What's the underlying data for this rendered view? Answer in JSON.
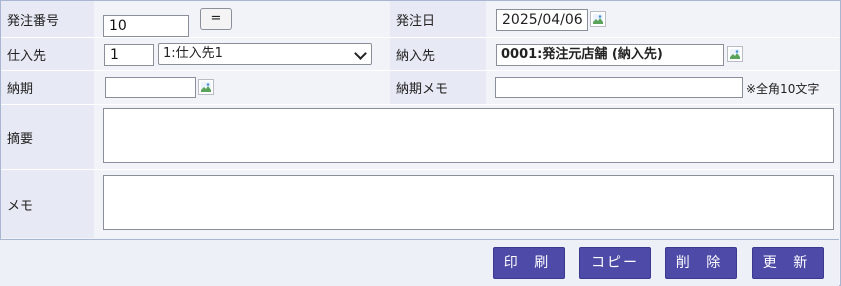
{
  "form": {
    "order_no": {
      "label": "発注番号",
      "value": "10",
      "copy_button": "="
    },
    "order_date": {
      "label": "発注日",
      "value": "2025/04/06"
    },
    "supplier": {
      "label": "仕入先",
      "code": "1",
      "selected": "1:仕入先1"
    },
    "destination": {
      "label": "納入先",
      "value": "0001:発注元店舗 (納入先)"
    },
    "delivery_date": {
      "label": "納期",
      "value": ""
    },
    "delivery_memo": {
      "label": "納期メモ",
      "value": "",
      "hint": "※全角10文字"
    },
    "summary": {
      "label": "摘要",
      "value": ""
    },
    "memo": {
      "label": "メモ",
      "value": ""
    }
  },
  "buttons": {
    "print": "印 刷",
    "copy": "コピー",
    "delete": "削 除",
    "update": "更 新"
  },
  "icons": {
    "date_picker": "broken-image-icon"
  }
}
